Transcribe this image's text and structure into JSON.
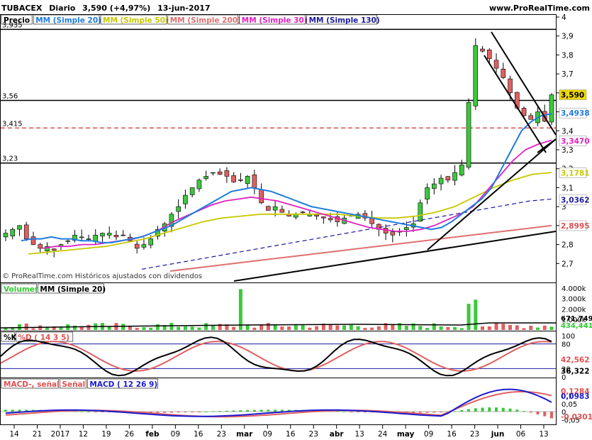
{
  "header": {
    "symbol": "TUBACEX",
    "period": "Diario",
    "last": "3,590 (+4,97%)",
    "date": "13-jun-2017",
    "site": "www.ProRealTime.com"
  },
  "price_panel": {
    "legend": [
      {
        "text": "Precio",
        "color": "#000000"
      },
      {
        "text": "MM (Simple 20)",
        "color": "#1e7be0"
      },
      {
        "text": "MM (Simple 50)",
        "color": "#c8c800"
      },
      {
        "text": "MM (Simple 200)",
        "color": "#e07070"
      },
      {
        "text": "MM (Simple 30)",
        "color": "#e020c0"
      },
      {
        "text": "MM (Simple 130)",
        "color": "#1a1aa0"
      }
    ],
    "level_labels": [
      "3,935",
      "3,56",
      "3,415",
      "3,23"
    ],
    "ticks": [
      "4",
      "3,9",
      "3,8",
      "3,7",
      "3,6",
      "3,5",
      "3,4",
      "3,3",
      "3,2",
      "3,1",
      "3",
      "2,9",
      "2,8",
      "2,7"
    ],
    "badges": [
      {
        "text": "3,590",
        "bg": "#f0d800",
        "fg": "#000000"
      },
      {
        "text": "3,4938",
        "bg": "#ffffff",
        "fg": "#1e7be0"
      },
      {
        "text": "3,3470",
        "bg": "#ffffff",
        "fg": "#e020c0"
      },
      {
        "text": "3,1781",
        "bg": "#ffffff",
        "fg": "#c8c800"
      },
      {
        "text": "3,0362",
        "bg": "#ffffff",
        "fg": "#1a1aa0"
      },
      {
        "text": "2,8995",
        "bg": "#ffffff",
        "fg": "#e05050"
      }
    ],
    "watermark": "© ProRealTime.com  Históricos ajustados con dividendos"
  },
  "volume_panel": {
    "legend": [
      {
        "text": "Volumen",
        "color": "#2ecc2e"
      },
      {
        "text": "MM (Simple 20)",
        "color": "#000000"
      }
    ],
    "ticks": [
      "4.000k",
      "3.000k",
      "2.000k",
      "1.000k"
    ],
    "badges": [
      {
        "text": "671,749",
        "fg": "#000000"
      },
      {
        "text": "434,441",
        "fg": "#2ecc2e"
      }
    ]
  },
  "stoch_panel": {
    "legend": [
      {
        "text": "%K",
        "color": "#000000"
      },
      {
        "text": "%D ( 14 3 5)",
        "color": "#e05050"
      }
    ],
    "ticks": [
      "100",
      "80",
      "20",
      "0"
    ],
    "badges": [
      {
        "text": "42,562",
        "fg": "#e05050"
      },
      {
        "text": "36,322",
        "fg": "#000000"
      }
    ]
  },
  "macd_panel": {
    "legend": [
      {
        "text": "MACD-, señal",
        "color": "#e05050"
      },
      {
        "text": "Señal",
        "color": "#e05050"
      },
      {
        "text": "MACD ( 12 26 9)",
        "color": "#1a1ad0"
      }
    ],
    "ticks": [
      "0,1",
      "0,05",
      "0",
      "-0,05"
    ],
    "badges": [
      {
        "text": "0,1284",
        "fg": "#e05050"
      },
      {
        "text": "0,0983",
        "fg": "#1a1ad0"
      },
      {
        "text": "-0,0301",
        "fg": "#e05050"
      }
    ]
  },
  "x_axis": [
    "14",
    "21",
    "2017",
    "12",
    "19",
    "26",
    "feb",
    "09",
    "16",
    "23",
    "mar",
    "09",
    "16",
    "23",
    "abr",
    "13",
    "24",
    "may",
    "09",
    "16",
    "23",
    "jun",
    "06",
    "13"
  ],
  "chart_data": {
    "type": "candlestick",
    "title": "TUBACEX Diario",
    "price": {
      "ylim": [
        2.65,
        4.0
      ],
      "close_path": [
        2.86,
        2.88,
        2.9,
        2.83,
        2.8,
        2.78,
        2.79,
        2.77,
        2.8,
        2.82,
        2.85,
        2.84,
        2.83,
        2.85,
        2.86,
        2.86,
        2.84,
        2.85,
        2.82,
        2.78,
        2.8,
        2.83,
        2.88,
        2.91,
        2.96,
        3.0,
        3.06,
        3.1,
        3.14,
        3.16,
        3.18,
        3.17,
        3.16,
        3.13,
        3.14,
        3.16,
        3.1,
        3.02,
        2.98,
        3.0,
        2.97,
        2.95,
        2.96,
        2.97,
        2.96,
        2.95,
        2.94,
        2.93,
        2.92,
        2.94,
        2.95,
        2.96,
        2.94,
        2.91,
        2.88,
        2.86,
        2.85,
        2.87,
        2.89,
        2.91,
        3.02,
        3.1,
        3.12,
        3.15,
        3.14,
        3.18,
        3.22,
        3.55,
        3.85,
        3.82,
        3.78,
        3.73,
        3.68,
        3.6,
        3.52,
        3.48,
        3.46,
        3.5,
        3.45,
        3.59
      ],
      "sma20": [
        2.82,
        2.83,
        2.83,
        2.84,
        2.83,
        2.83,
        2.82,
        2.82,
        2.81,
        2.81,
        2.82,
        2.83,
        2.84,
        2.86,
        2.88,
        2.9,
        2.93,
        2.96,
        2.99,
        3.02,
        3.05,
        3.08,
        3.09,
        3.1,
        3.09,
        3.08,
        3.06,
        3.04,
        3.02,
        3.0,
        2.99,
        2.98,
        2.97,
        2.96,
        2.95,
        2.94,
        2.93,
        2.92,
        2.91,
        2.9,
        2.89,
        2.88,
        2.89,
        2.92,
        2.96,
        3.0,
        3.04,
        3.1,
        3.2,
        3.3,
        3.4,
        3.45,
        3.48,
        3.49
      ],
      "sma30": [
        2.78,
        2.79,
        2.79,
        2.8,
        2.8,
        2.81,
        2.82,
        2.83,
        2.85,
        2.88,
        2.92,
        2.95,
        2.98,
        3.01,
        3.03,
        3.04,
        3.05,
        3.04,
        3.03,
        3.01,
        2.99,
        2.97,
        2.95,
        2.93,
        2.91,
        2.89,
        2.88,
        2.87,
        2.87,
        2.88,
        2.9,
        2.93,
        2.96,
        3.0,
        3.08,
        3.16,
        3.24,
        3.3,
        3.33,
        3.35
      ],
      "sma50": [
        2.75,
        2.76,
        2.77,
        2.78,
        2.79,
        2.81,
        2.83,
        2.86,
        2.89,
        2.92,
        2.94,
        2.95,
        2.96,
        2.96,
        2.96,
        2.96,
        2.96,
        2.95,
        2.94,
        2.94,
        2.95,
        2.97,
        3.0,
        3.05,
        3.1,
        3.14,
        3.17,
        3.18
      ],
      "sma130": [
        2.67,
        2.69,
        2.71,
        2.73,
        2.75,
        2.77,
        2.79,
        2.81,
        2.83,
        2.85,
        2.87,
        2.89,
        2.91,
        2.93,
        2.95,
        2.97,
        2.99,
        3.01,
        3.03,
        3.04
      ],
      "sma200": [
        2.66,
        2.68,
        2.7,
        2.72,
        2.74,
        2.76,
        2.78,
        2.8,
        2.82,
        2.84,
        2.86,
        2.88,
        2.9
      ]
    },
    "volume": {
      "unit": "k",
      "ylim": [
        0,
        4200
      ],
      "spikes": [
        3900,
        2500,
        2900
      ]
    },
    "stochastic": {
      "ylim": [
        0,
        100
      ],
      "k_last": 36.322,
      "d_last": 42.562
    },
    "macd": {
      "macd_last": 0.0983,
      "signal_last": 0.1284,
      "hist_last": -0.0301
    }
  }
}
